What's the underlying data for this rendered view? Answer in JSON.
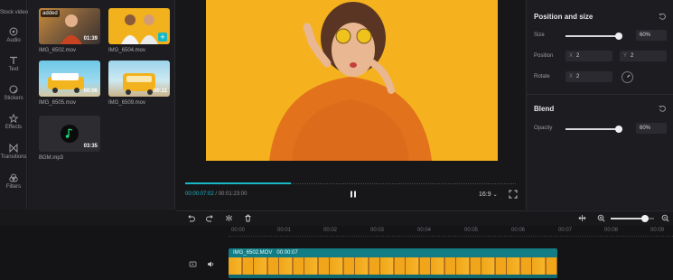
{
  "sidebar": {
    "items": [
      {
        "label": "Stock videos",
        "icon": "stock-videos-icon"
      },
      {
        "label": "Audio",
        "icon": "audio-icon"
      },
      {
        "label": "Text",
        "icon": "text-icon"
      },
      {
        "label": "Stickers",
        "icon": "stickers-icon"
      },
      {
        "label": "Effects",
        "icon": "effects-icon"
      },
      {
        "label": "Transitions",
        "icon": "transitions-icon"
      },
      {
        "label": "Filters",
        "icon": "filters-icon"
      }
    ]
  },
  "media": {
    "items": [
      {
        "name": "IMG_6502.mov",
        "duration": "01:39",
        "badge": "added"
      },
      {
        "name": "IMG_6504.mov",
        "duration": ""
      },
      {
        "name": "IMG_6505.mov",
        "duration": "00:06"
      },
      {
        "name": "IMG_6509.mov",
        "duration": "00:11"
      },
      {
        "name": "BGM.mp3",
        "duration": "03:35"
      }
    ]
  },
  "player": {
    "current_time": "00:00:07:02",
    "total_time": "/ 00:01:23:00",
    "aspect_ratio": "16:9",
    "progress": 0.32
  },
  "properties": {
    "position_size": {
      "title": "Position and size",
      "size_label": "Size",
      "size_value": "60%",
      "size_level": 0.95,
      "position_label": "Position",
      "position_x_axis": "X",
      "position_x": "2",
      "position_y_axis": "Y",
      "position_y": "2",
      "rotate_label": "Rotate",
      "rotate_axis": "X",
      "rotate_value": "2"
    },
    "blend": {
      "title": "Blend",
      "opacity_label": "Opacity",
      "opacity_value": "60%",
      "opacity_level": 0.95
    }
  },
  "timeline": {
    "ruler_ticks": [
      "00:00",
      "00:01",
      "00:02",
      "00:03",
      "00:04",
      "00:05",
      "00:06",
      "00:07",
      "00:08",
      "00:09"
    ],
    "clip": {
      "name": "IMG_6502.MOV",
      "duration": "00:00:07"
    },
    "zoom_level": 0.8
  },
  "colors": {
    "accent": "#19b8c6",
    "video_bg": "#f5b21e"
  }
}
